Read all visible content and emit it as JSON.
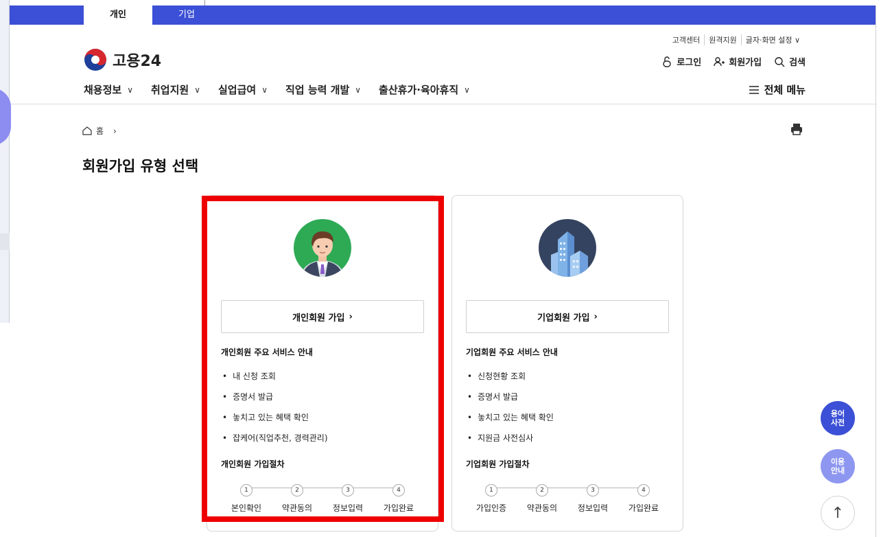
{
  "topbar": {
    "tab_personal": "개인",
    "tab_corp": "기업",
    "accent": "#3b50d6"
  },
  "util_links": [
    "고객센터",
    "원격지원",
    "글자·화면 설정 ∨"
  ],
  "logo": {
    "name": "고용24"
  },
  "auth": {
    "login": "로그인",
    "signup": "회원가입",
    "search": "검색"
  },
  "gnb": [
    "채용정보",
    "취업지원",
    "실업급여",
    "직업 능력 개발",
    "출산휴가·육아휴직"
  ],
  "all_menu": "전체 메뉴",
  "breadcrumb": {
    "home": "홈"
  },
  "page_title": "회원가입 유형 선택",
  "personal": {
    "join_button": "개인회원 가입",
    "services_title": "개인회원 주요 서비스 안내",
    "services": [
      "내 신청 조회",
      "증명서 발급",
      "놓치고 있는 혜택 확인",
      "잡케어(직업추천, 경력관리)"
    ],
    "process_title": "개인회원 가입절차",
    "steps": [
      {
        "num": "1",
        "label": "본인확인"
      },
      {
        "num": "2",
        "label": "약관동의"
      },
      {
        "num": "3",
        "label": "정보입력"
      },
      {
        "num": "4",
        "label": "가입완료"
      }
    ]
  },
  "corp": {
    "join_button": "기업회원 가입",
    "services_title": "기업회원 주요 서비스 안내",
    "services": [
      "신청현황 조회",
      "증명서 발급",
      "놓치고 있는 혜택 확인",
      "지원금 사전심사"
    ],
    "process_title": "기업회원 가입절차",
    "steps": [
      {
        "num": "1",
        "label": "가입인증"
      },
      {
        "num": "2",
        "label": "약관동의"
      },
      {
        "num": "3",
        "label": "정보입력"
      },
      {
        "num": "4",
        "label": "가입완료"
      }
    ]
  },
  "floating": {
    "dictionary": "용어\n사전",
    "guide": "이용\n안내",
    "top": "↑"
  },
  "colors": {
    "highlight": "#ee0000",
    "dict_bg": "#3b50d6",
    "guide_bg": "#8e97f0"
  }
}
